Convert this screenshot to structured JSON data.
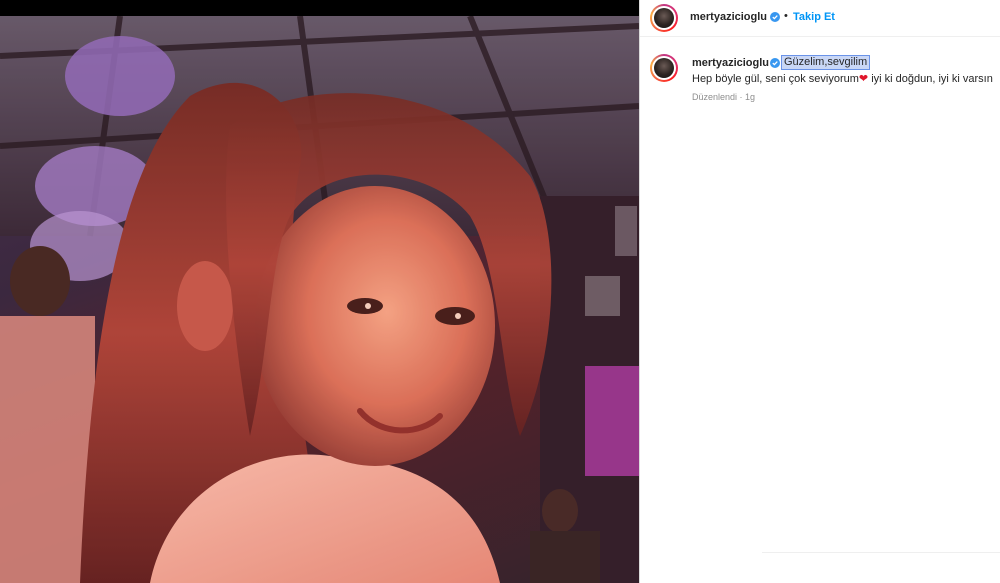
{
  "post": {
    "image_description_icon": "photo",
    "accent_color": "#0095f6",
    "verified_color": "#3897f0"
  },
  "header": {
    "username": "mertyazicioglu",
    "separator": "•",
    "follow_label": "Takip Et"
  },
  "caption": {
    "username": "mertyazicioglu",
    "title": "Güzelim,sevgilim",
    "body_before_heart": "Hep böyle gül, seni çok seviyorum",
    "heart_icon": "❤",
    "body_after_heart": " iyi ki doğdun, iyi ki varsın",
    "meta": "Düzenlendi · 1g"
  }
}
